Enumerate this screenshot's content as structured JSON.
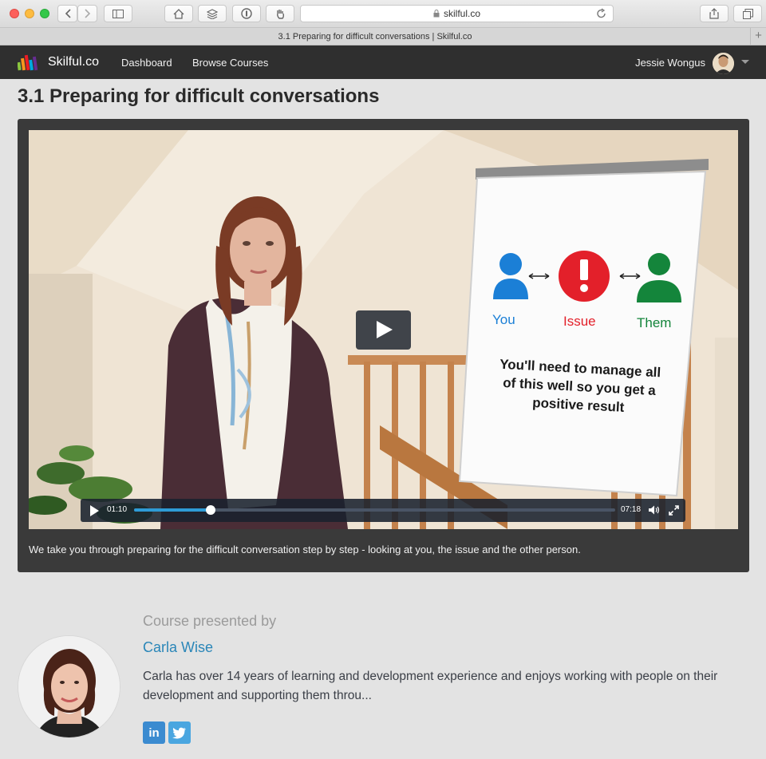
{
  "browser": {
    "url": "skilful.co",
    "tab_title": "3.1 Preparing for difficult conversations | Skilful.co"
  },
  "nav": {
    "brand": "Skilful.co",
    "links": [
      "Dashboard",
      "Browse Courses"
    ],
    "user_name": "Jessie Wongus"
  },
  "page": {
    "title": "3.1 Preparing for difficult conversations"
  },
  "video": {
    "flipchart": {
      "labels": [
        "You",
        "Issue",
        "Them"
      ],
      "text_lines": [
        "You'll need to manage all",
        "of this well so you get a",
        "positive result"
      ]
    },
    "current_time": "01:10",
    "duration": "07:18",
    "progress": 0.16,
    "caption": "We take you through preparing for the difficult conversation step by step - looking at you, the issue and the other person."
  },
  "presenter": {
    "heading": "Course presented by",
    "name": "Carla Wise",
    "bio": "Carla has over 14 years of learning and development experience and enjoys working with people on their development and supporting them throu...",
    "social": [
      "in",
      "t"
    ]
  },
  "colors": {
    "you": "#1b7fd6",
    "issue": "#e3202a",
    "them": "#14853b",
    "accent": "#2a86b8",
    "progress": "#2e9bd6"
  }
}
